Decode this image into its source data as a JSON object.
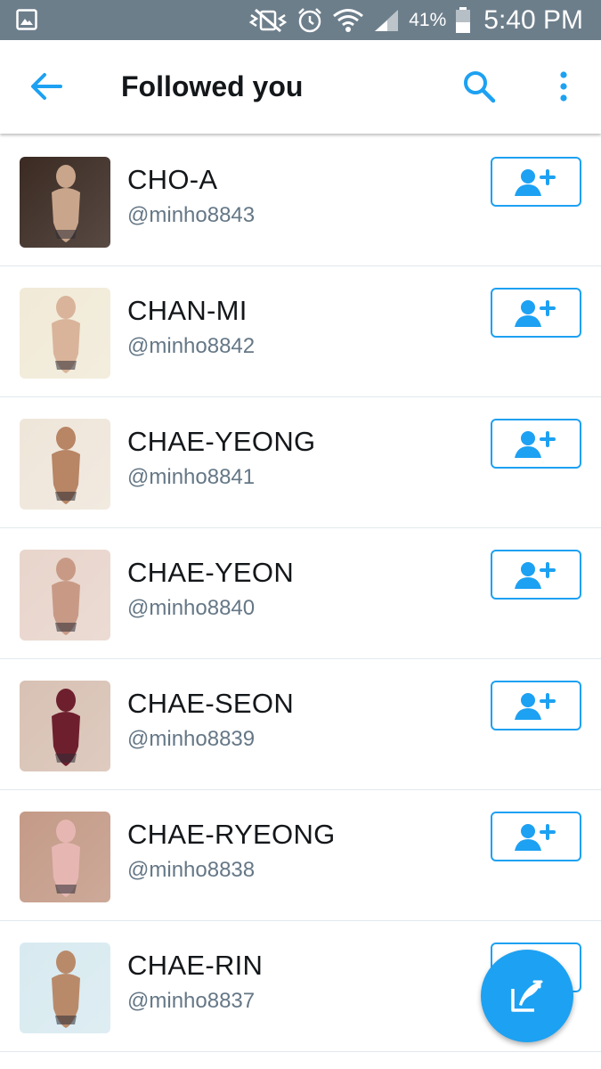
{
  "status_bar": {
    "battery_percent": "41%",
    "time": "5:40 PM",
    "icons": [
      "gallery-icon",
      "mute-vibrate-icon",
      "alarm-icon",
      "wifi-icon",
      "signal-icon",
      "battery-icon"
    ]
  },
  "header": {
    "title": "Followed you",
    "back_icon": "arrow-left-icon",
    "search_icon": "search-icon",
    "more_icon": "more-vertical-icon"
  },
  "users": [
    {
      "name": "CHO-A",
      "handle": "@minho8843",
      "avatar_tone": [
        "#3a2a22",
        "#c9a58b"
      ]
    },
    {
      "name": "CHAN-MI",
      "handle": "@minho8842",
      "avatar_tone": [
        "#f1ead8",
        "#d9b49a"
      ]
    },
    {
      "name": "CHAE-YEONG",
      "handle": "@minho8841",
      "avatar_tone": [
        "#efe6da",
        "#b88565"
      ]
    },
    {
      "name": "CHAE-YEON",
      "handle": "@minho8840",
      "avatar_tone": [
        "#e8d5cc",
        "#c89a86"
      ]
    },
    {
      "name": "CHAE-SEON",
      "handle": "@minho8839",
      "avatar_tone": [
        "#d8c1b4",
        "#6e1f2e"
      ]
    },
    {
      "name": "CHAE-RYEONG",
      "handle": "@minho8838",
      "avatar_tone": [
        "#c49a87",
        "#e6b7b2"
      ]
    },
    {
      "name": "CHAE-RIN",
      "handle": "@minho8837",
      "avatar_tone": [
        "#d8eaf0",
        "#b98a6a"
      ]
    }
  ],
  "follow_button_icon": "add-user-icon",
  "fab_icon": "compose-tweet-icon",
  "colors": {
    "accent": "#1da1f2",
    "status_bar": "#6d7e8b",
    "text_primary": "#14171a",
    "text_secondary": "#657786"
  }
}
